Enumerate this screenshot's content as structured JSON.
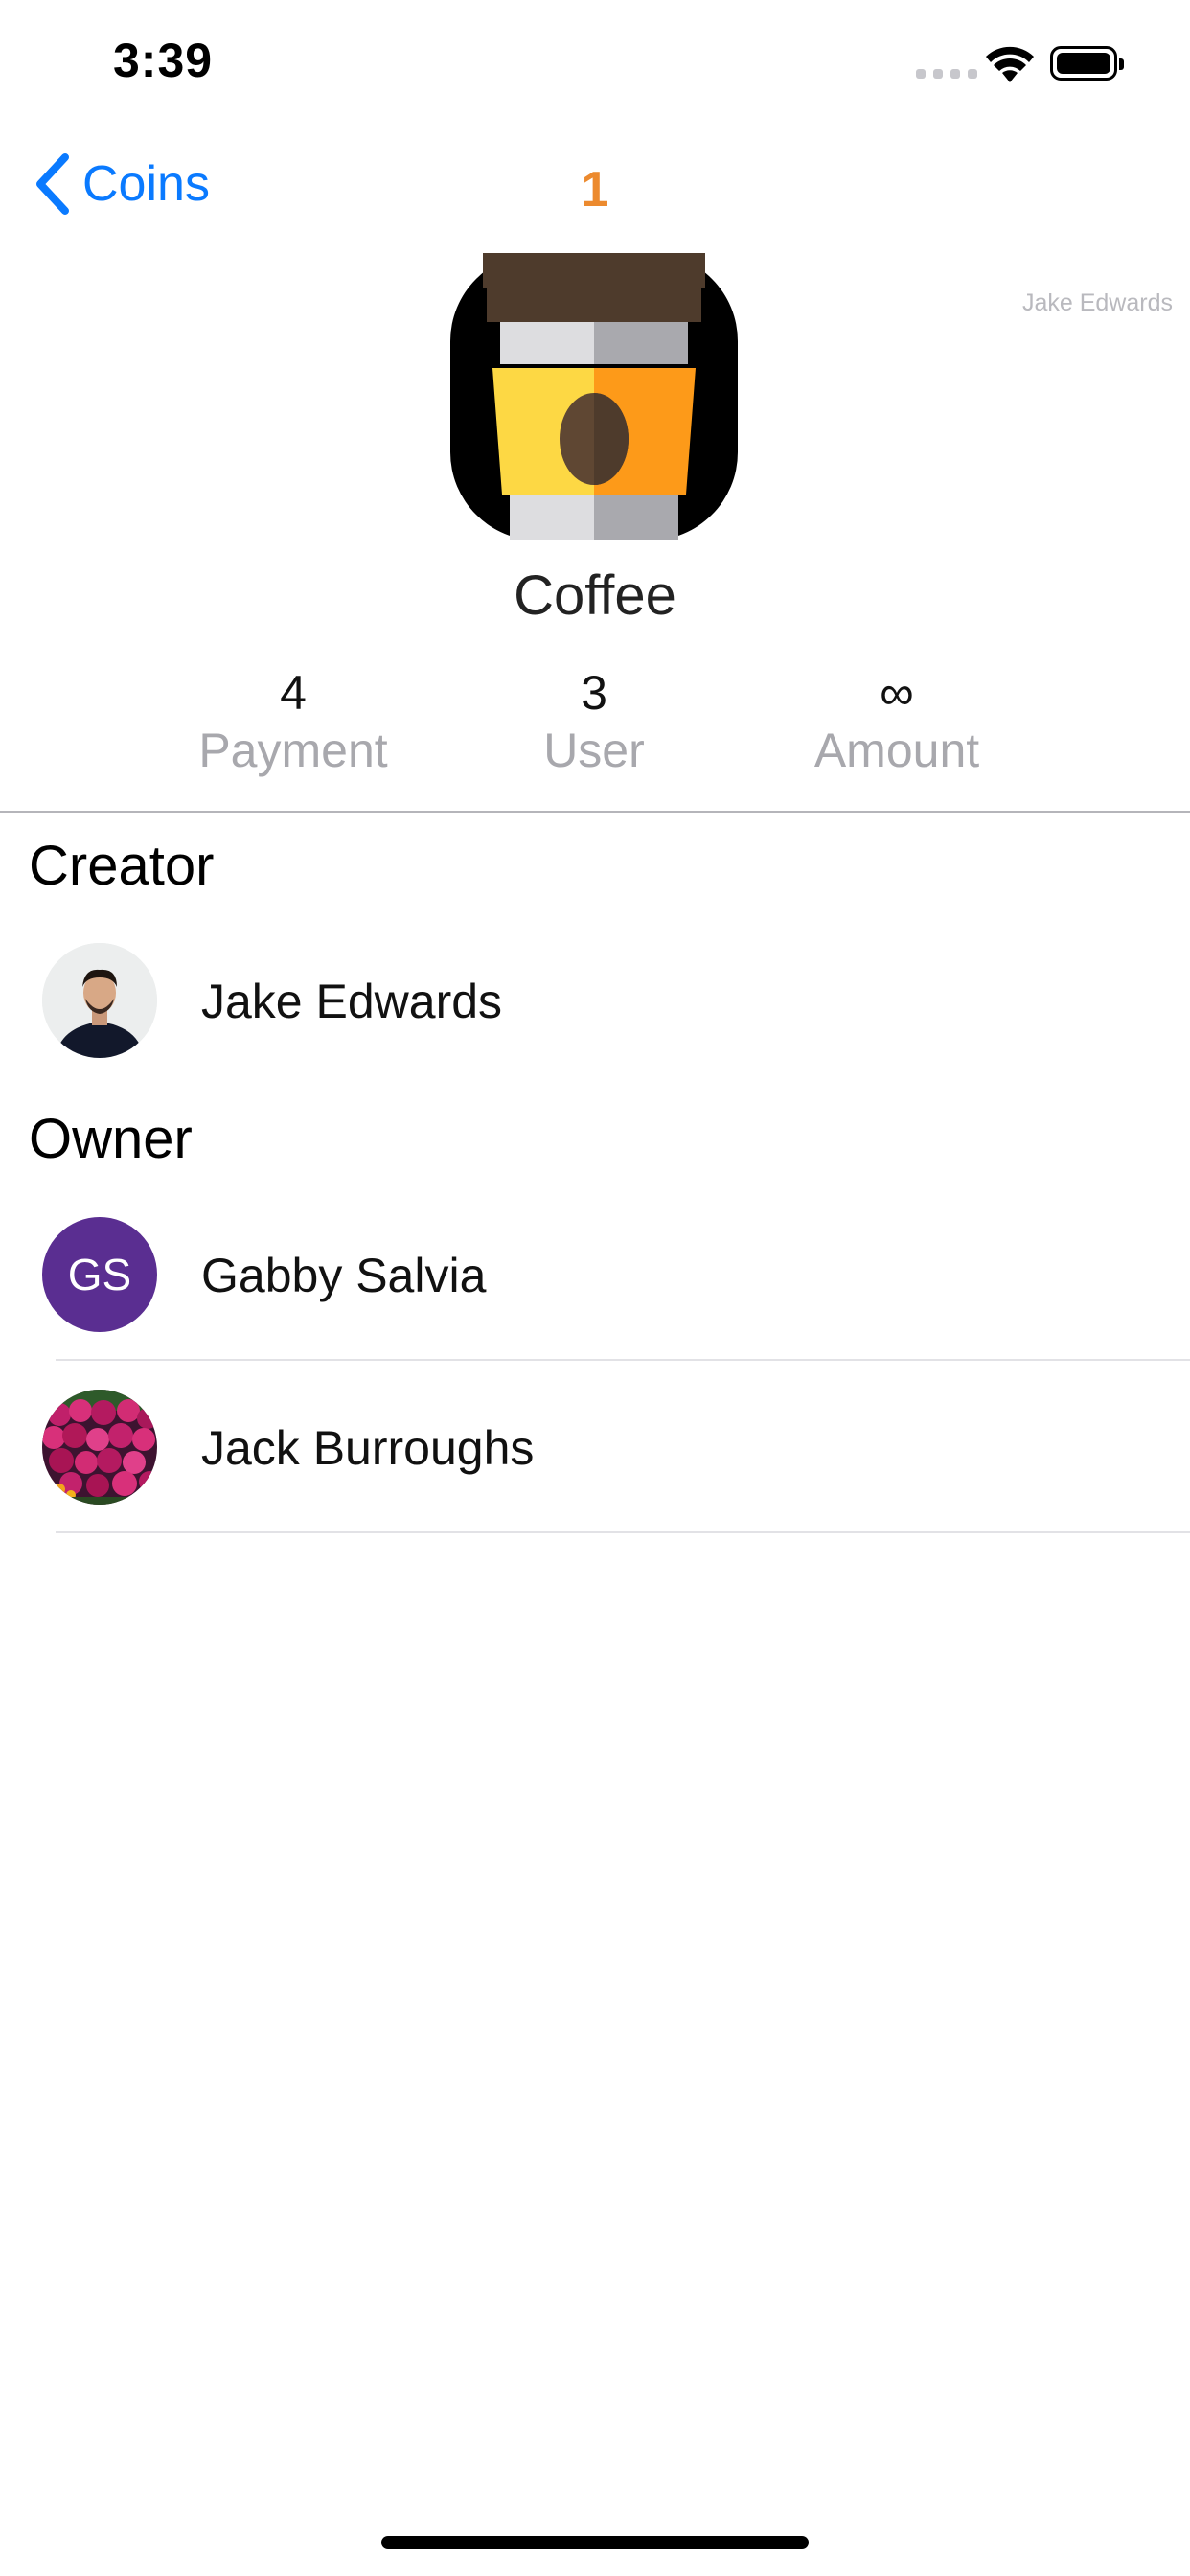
{
  "status_bar": {
    "time": "3:39"
  },
  "nav": {
    "back_label": "Coins",
    "count": "1"
  },
  "watermark": "Jake Edwards",
  "coin": {
    "name": "Coffee"
  },
  "stats": [
    {
      "value": "4",
      "label": "Payment"
    },
    {
      "value": "3",
      "label": "User"
    },
    {
      "value": "∞",
      "label": "Amount"
    }
  ],
  "sections": {
    "creator_title": "Creator",
    "owner_title": "Owner"
  },
  "creator": {
    "name": "Jake Edwards",
    "avatar": "photo"
  },
  "owners": [
    {
      "name": "Gabby Salvia",
      "initials": "GS",
      "avatar_color": "#5a2e91"
    },
    {
      "name": "Jack Burroughs",
      "avatar": "flowers-photo"
    }
  ],
  "colors": {
    "accent": "#0a7aff",
    "count": "#ec8a2e"
  }
}
